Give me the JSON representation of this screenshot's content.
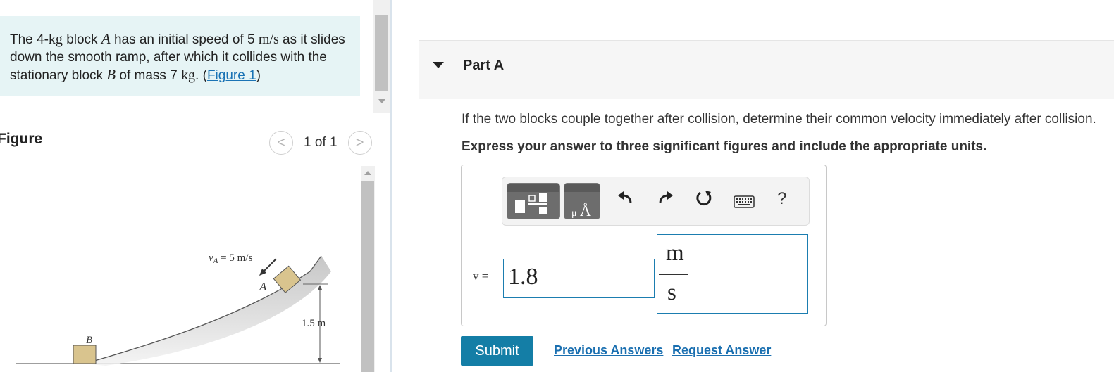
{
  "problem": {
    "text_1": "The 4-",
    "kg_1": "kg",
    "text_2": " block ",
    "block_a": "A",
    "text_3": " has an initial speed of 5 ",
    "speed_unit": "m/s",
    "text_4": " as it slides down the smooth ramp, after which it collides with the stationary block ",
    "block_b": "B",
    "text_5": " of mass 7 ",
    "kg_2": "kg",
    "text_6": ". (",
    "figure_link": "Figure 1",
    "text_7": ")"
  },
  "figure": {
    "title": "Figure",
    "page_count": "1 of 1",
    "prev_glyph": "<",
    "next_glyph": ">",
    "labels": {
      "velocity": "v",
      "velocity_sub": "A",
      "velocity_value": " = 5 m/s",
      "block_a": "A",
      "block_b": "B",
      "height": "1.5 m"
    }
  },
  "part": {
    "title": "Part A",
    "question": "If the two blocks couple together after collision, determine their common velocity immediately after collision.",
    "instruction": "Express your answer to three significant figures and include the appropriate units."
  },
  "answer": {
    "variable": "v =",
    "value": "1.8",
    "unit_numerator": "m",
    "unit_denominator": "s",
    "toolbar": {
      "undo_icon": "undo-icon",
      "redo_icon": "redo-icon",
      "reset_icon": "reset-icon",
      "keyboard_icon": "keyboard-icon",
      "help": "?"
    }
  },
  "actions": {
    "submit": "Submit",
    "previous_answers": "Previous Answers",
    "request_answer": "Request Answer"
  },
  "colors": {
    "problem_bg": "#e6f4f5",
    "accent": "#147ea6",
    "link": "#1a6fb0",
    "block_fill": "#d9c48e"
  }
}
